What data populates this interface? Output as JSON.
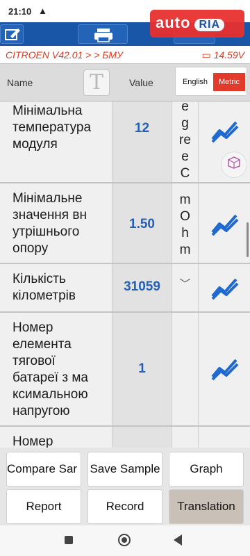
{
  "status_bar": {
    "time": "21:10",
    "warning_icon": "warning-icon"
  },
  "watermark": {
    "brand": "auto",
    "brand_badge": "RIA"
  },
  "breadcrumb": {
    "path": "CITROEN V42.01 > > БМУ",
    "voltage": "14.59V"
  },
  "header": {
    "name_label": "Name",
    "translate_icon": "T",
    "value_label": "Value",
    "units": {
      "english": "English",
      "metric": "Metric",
      "selected": "Metric"
    }
  },
  "rows": [
    {
      "name": "Мінімальна температура модуля",
      "value": "12",
      "unit": "egreeC",
      "graph_icon": "trend-graph-icon"
    },
    {
      "name": "Мінімальне значення вн утрішнього опору",
      "value": "1.50",
      "unit": "mOhm",
      "graph_icon": "trend-graph-icon"
    },
    {
      "name": "Кількість кілометрів",
      "value": "31059",
      "unit": "",
      "graph_icon": "trend-graph-icon"
    },
    {
      "name": "Номер елемента тягової батареї з ма ксимальною напругою",
      "value": "1",
      "unit": "",
      "graph_icon": "trend-graph-icon"
    },
    {
      "name": "Номер",
      "value": "",
      "unit": "",
      "graph_icon": "trend-graph-icon"
    }
  ],
  "buttons": {
    "compare_sample": "Compare Sar",
    "save_sample": "Save Sample",
    "graph": "Graph",
    "report": "Report",
    "record": "Record",
    "translation": "Translation"
  },
  "colors": {
    "accent": "#1a56a8",
    "highlight": "#e03a1f",
    "value": "#2360b8"
  }
}
